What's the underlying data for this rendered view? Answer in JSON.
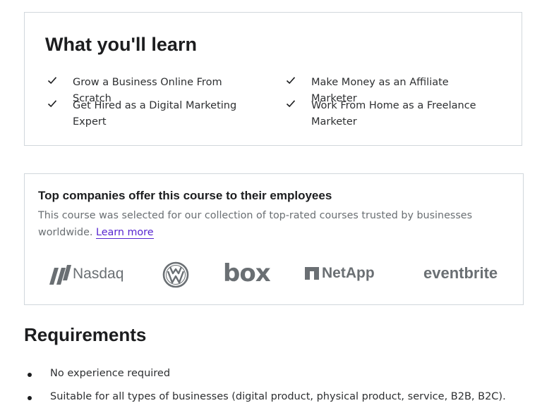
{
  "learn": {
    "title": "What you'll learn",
    "items": [
      {
        "text": "Grow a Business Online From Scratch",
        "icon": "check-icon"
      },
      {
        "text": "Make Money as an Affiliate Marketer",
        "icon": "check-icon"
      },
      {
        "text": "Get Hired as a Digital Marketing Expert",
        "icon": "check-icon"
      },
      {
        "text": "Work From Home as a Freelance Marketer",
        "icon": "check-icon"
      }
    ]
  },
  "companies": {
    "title": "Top companies offer this course to their employees",
    "description": "This course was selected for our collection of top-rated courses trusted by businesses worldwide.",
    "learn_more": "Learn more",
    "logos": [
      "Nasdaq",
      "Volkswagen",
      "box",
      "NetApp",
      "eventbrite"
    ]
  },
  "requirements": {
    "title": "Requirements",
    "items": [
      "No experience required",
      "Suitable for all types of businesses (digital product, physical product, service, B2B, B2C)."
    ]
  },
  "colors": {
    "link": "#5624d0",
    "border": "#d1d7dc",
    "muted": "#6a6f73"
  }
}
